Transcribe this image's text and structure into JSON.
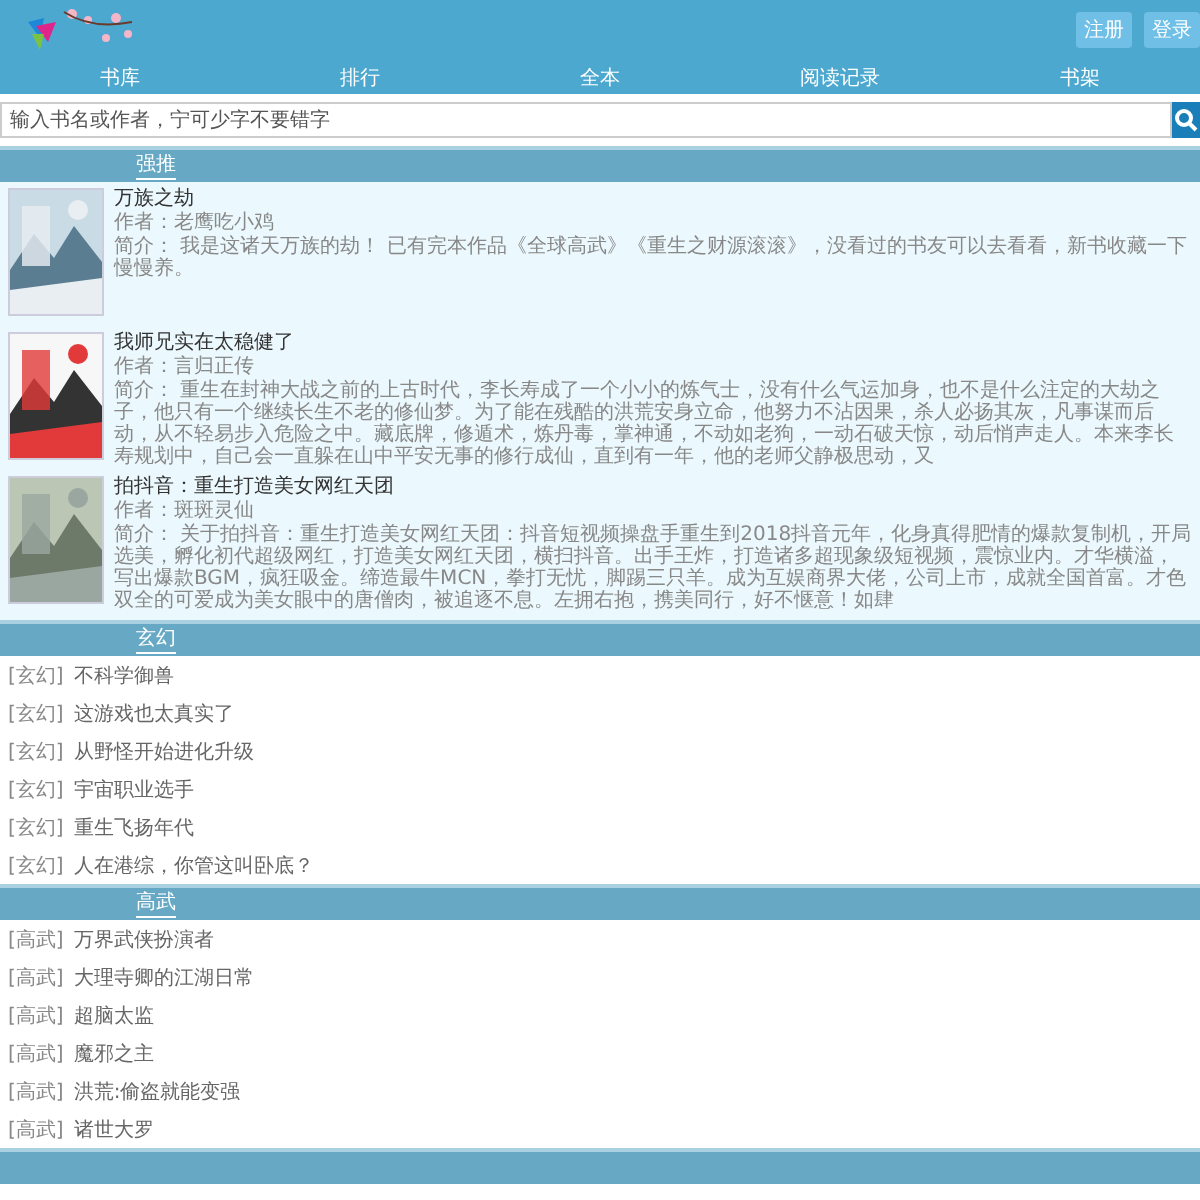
{
  "header": {
    "buttons": [
      "注册",
      "登录"
    ]
  },
  "nav": [
    "书库",
    "排行",
    "全本",
    "阅读记录",
    "书架"
  ],
  "search": {
    "placeholder": "输入书名或作者，宁可少字不要错字"
  },
  "featured": {
    "title": "强推",
    "books": [
      {
        "kind": "picture",
        "title": "万族之劫",
        "author": "作者：老鹰吃小鸡",
        "summary": "简介： 我是这诸天万族的劫！ 已有完本作品《全球高武》《重生之财源滚滚》，没看过的书友可以去看看，新书收藏一下慢慢养。"
      },
      {
        "kind": "picture",
        "title": "我师兄实在太稳健了",
        "author": "作者：言归正传",
        "summary": "简介： 重生在封神大战之前的上古时代，李长寿成了一个小小的炼气士，没有什么气运加身，也不是什么注定的大劫之子，他只有一个继续长生不老的修仙梦。为了能在残酷的洪荒安身立命，他努力不沾因果，杀人必扬其灰，凡事谋而后动，从不轻易步入危险之中。藏底牌，修遁术，炼丹毒，掌神通，不动如老狗，一动石破天惊，动后悄声走人。本来李长寿规划中，自己会一直躲在山中平安无事的修行成仙，直到有一年，他的老师父静极思动，又"
      },
      {
        "kind": "picture",
        "title": "拍抖音：重生打造美女网红天团",
        "author": "作者：斑斑灵仙",
        "summary": "简介： 关于拍抖音：重生打造美女网红天团：抖音短视频操盘手重生到2018抖音元年，化身真得肥情的爆款复制机，开局选美，孵化初代超级网红，打造美女网红天团，横扫抖音。出手王炸，打造诸多超现象级短视频，震惊业内。才华横溢，写出爆款BGM，疯狂吸金。缔造最牛MCN，拳打无忧，脚踢三只羊。成为互娱商界大佬，公司上市，成就全国首富。才色双全的可爱成为美女眼中的唐僧肉，被追逐不息。左拥右抱，携美同行，好不惬意！如肆"
      }
    ]
  },
  "categories": [
    {
      "title": "玄幻",
      "items": [
        {
          "tag": "[玄幻]",
          "name": "不科学御兽"
        },
        {
          "tag": "[玄幻]",
          "name": "这游戏也太真实了"
        },
        {
          "tag": "[玄幻]",
          "name": "从野怪开始进化升级"
        },
        {
          "tag": "[玄幻]",
          "name": "宇宙职业选手"
        },
        {
          "tag": "[玄幻]",
          "name": "重生飞扬年代"
        },
        {
          "tag": "[玄幻]",
          "name": "人在港综，你管这叫卧底？"
        }
      ]
    },
    {
      "title": "高武",
      "items": [
        {
          "tag": "[高武]",
          "name": "万界武侠扮演者"
        },
        {
          "tag": "[高武]",
          "name": "大理寺卿的江湖日常"
        },
        {
          "tag": "[高武]",
          "name": "超脑太监"
        },
        {
          "tag": "[高武]",
          "name": "魔邪之主"
        },
        {
          "tag": "[高武]",
          "name": "洪荒:偷盗就能变强"
        },
        {
          "tag": "[高武]",
          "name": "诸世大罗"
        }
      ]
    }
  ]
}
